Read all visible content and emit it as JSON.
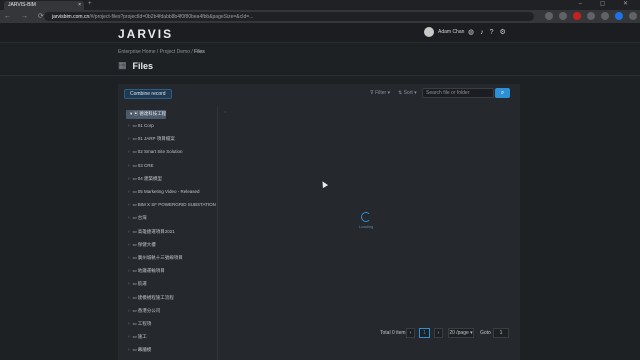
{
  "browser": {
    "tab_title": "JARVIS-BIM",
    "url_host": "jarvisbim.com.cn",
    "url_rest": "/#/project-files?projectId=0b2b4fdabb8b4f0f80bea4fbb&pageSize=&cId=...",
    "accent": "#1a73e8"
  },
  "app": {
    "logo": "JARVIS",
    "user_name": "Adam Chan",
    "icons": [
      "globe-icon",
      "bell-icon",
      "help-icon",
      "gear-icon"
    ]
  },
  "breadcrumb": {
    "items": [
      "Enterprise Home",
      "Project Demo",
      "Files"
    ],
    "sep": "/"
  },
  "page": {
    "title": "Files"
  },
  "toolbar": {
    "combine_label": "Combine record",
    "filter_label": "Filter",
    "sort_label": "Sort",
    "search_placeholder": "Search file or folder"
  },
  "tree": {
    "root": "德達科技工程",
    "items": [
      "01 Corp",
      "01 JARP 項目檔案",
      "02 Smart Site Solution",
      "03 CRE",
      "04 建築模型",
      "05 Marketing Video - Released",
      "BIM X SF POWERGRID SUBSTATION ON ()",
      "台灣",
      "高雄捷運項目2021",
      "保健大樓",
      "廣州城軌十三號線項目",
      "地鐵運輸項目",
      "航運",
      "建模規程施工流程",
      "香港分公司",
      "工程項",
      "施工",
      "幕牆模"
    ]
  },
  "loading": {
    "text": "Loading"
  },
  "pagination": {
    "total": "Total 0 item",
    "current_page": "1",
    "page_size": "20 /page",
    "goto_label": "Goto",
    "goto_value": "1"
  }
}
